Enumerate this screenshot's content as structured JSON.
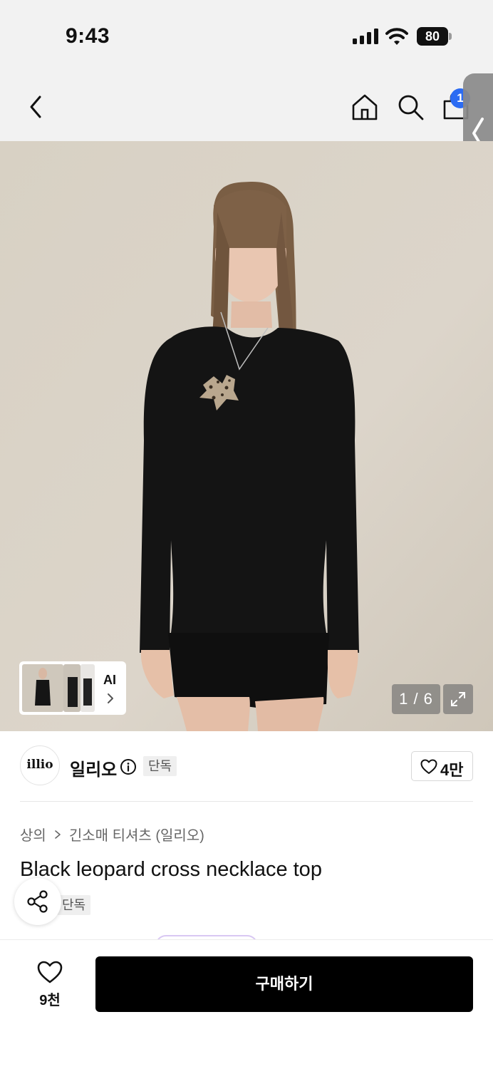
{
  "status_bar": {
    "time": "9:43",
    "battery": "80"
  },
  "nav": {
    "back_icon": "chevron-left-icon",
    "home_icon": "home-icon",
    "search_icon": "search-icon",
    "bag_icon": "shopping-bag-icon",
    "cart_badge": "1"
  },
  "gallery": {
    "ai_label": "AI",
    "counter": "1 / 6",
    "expand_icon": "expand-icon"
  },
  "brand": {
    "logo_text": "illio",
    "name": "일리오",
    "exclusive_tag": "단독",
    "likes": "4만"
  },
  "product": {
    "breadcrumb": [
      "상의",
      "긴소매 티셔츠 (일리오)"
    ],
    "title": "Black leopard cross necklace top",
    "exclusive_tag": "단독"
  },
  "bottom_bar": {
    "wish_count": "9천",
    "buy_label": "구매하기"
  },
  "colors": {
    "accent_badge": "#2b6bf3",
    "buy_button": "#000000",
    "photo_background": "#d9d2c6"
  }
}
